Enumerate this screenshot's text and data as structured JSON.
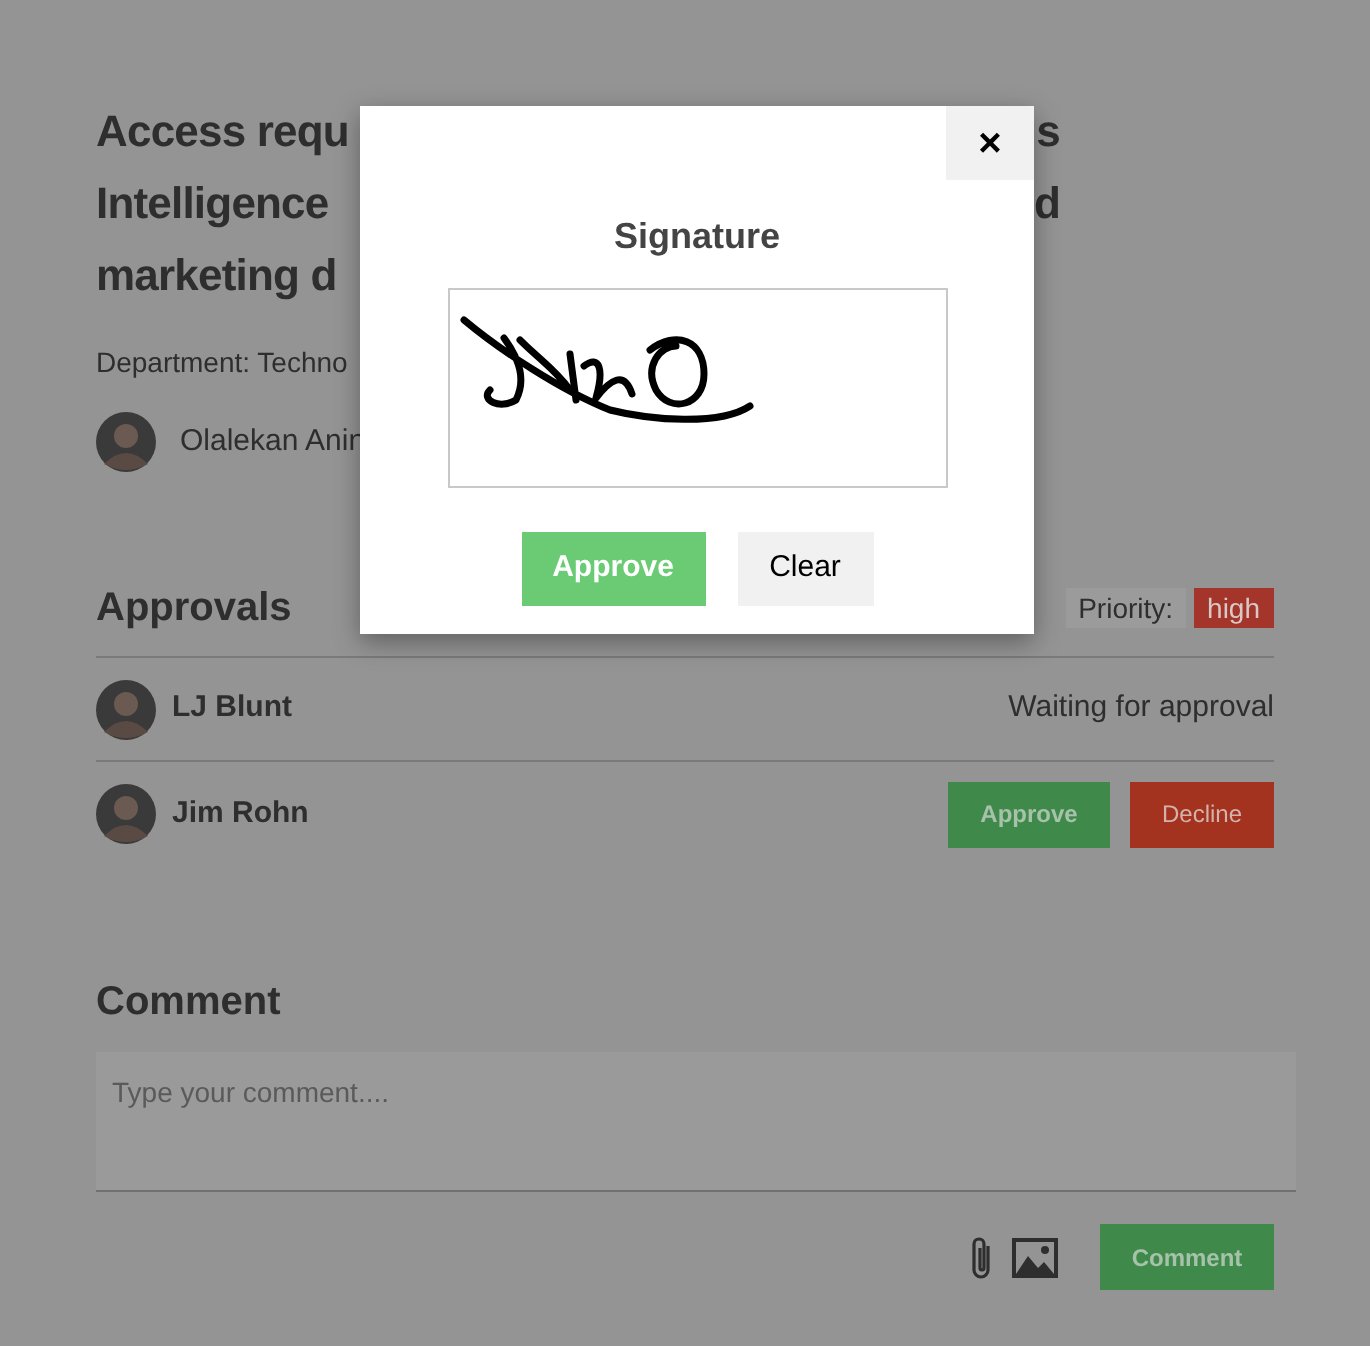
{
  "background_page": {
    "title_fragments": [
      {
        "left": "Access requ",
        "right": "s"
      },
      {
        "left": "Intelligence",
        "right": "d"
      },
      {
        "left": "marketing d"
      }
    ],
    "department": "Department: Techno",
    "author": {
      "name": "Olalekan Anin"
    }
  },
  "approvals": {
    "heading": "Approvals",
    "priority_label": "Priority:",
    "priority": "high",
    "approvers": [
      {
        "name": "LJ Blunt",
        "kind": "status",
        "status": "Waiting for approval"
      },
      {
        "name": "Jim Rohn",
        "kind": "actions",
        "approve": "Approve",
        "decline": "Decline"
      }
    ]
  },
  "comment": {
    "heading": "Comment",
    "placeholder": "Type your comment....",
    "button": "Comment"
  },
  "signature_dialog": {
    "close": "×",
    "title": "Signature",
    "approve": "Approve",
    "clear": "Clear"
  }
}
